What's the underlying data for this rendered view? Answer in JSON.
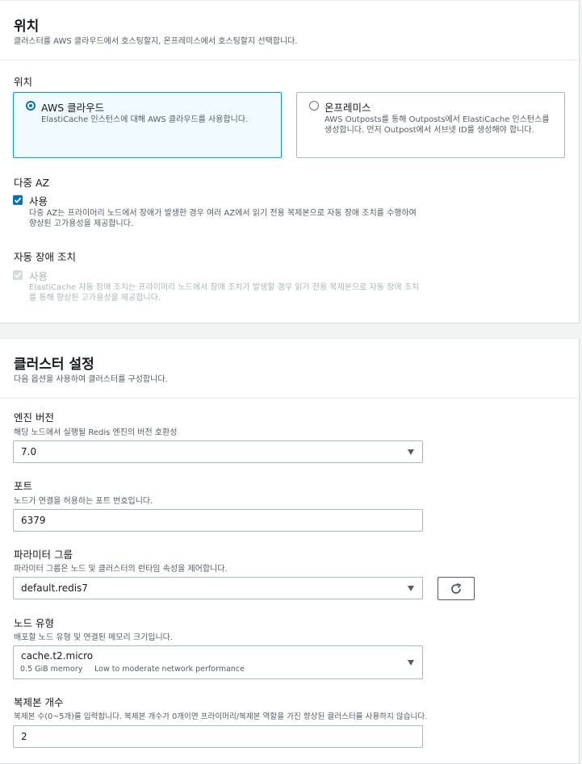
{
  "location_section": {
    "title": "위치",
    "description": "클러스터를 AWS 클라우드에서 호스팅할지, 온프레미스에서 호스팅할지 선택합니다.",
    "field_label": "위치",
    "options": [
      {
        "label": "AWS 클라우드",
        "description": "ElastiCache 인스턴스에 대해 AWS 클라우드를 사용합니다.",
        "selected": true
      },
      {
        "label": "온프레미스",
        "description": "AWS Outposts를 통해 Outposts에서 ElastiCache 인스턴스를 생성합니다. 먼저 Outpost에서 서브넷 ID를 생성해야 합니다.",
        "selected": false
      }
    ],
    "multi_az": {
      "label": "다중 AZ",
      "checkbox_label": "사용",
      "checked": true,
      "description": "다중 AZ는 프라이머리 노드에서 장애가 발생한 경우 여러 AZ에서 읽기 전용 복제본으로 자동 장애 조치를 수행하여 향상된 고가용성을 제공합니다."
    },
    "auto_failover": {
      "label": "자동 장애 조치",
      "checkbox_label": "사용",
      "checked": true,
      "disabled": true,
      "description": "ElastiCache 자동 장애 조치는 프라이머리 노드에서 장애 조치가 발생할 경우 읽기 전용 복제본으로 자동 장애 조치를 통해 향상된 고가용성을 제공합니다."
    }
  },
  "cluster_settings": {
    "title": "클러스터 설정",
    "description": "다음 옵션을 사용하여 클러스터를 구성합니다.",
    "engine_version": {
      "label": "엔진 버전",
      "description": "해당 노드에서 실행될 Redis 엔진의 버전 호환성",
      "value": "7.0"
    },
    "port": {
      "label": "포트",
      "description": "노드가 연결을 허용하는 포트 번호입니다.",
      "value": "6379"
    },
    "parameter_group": {
      "label": "파라미터 그룹",
      "description": "파라미터 그룹은 노드 및 클러스터의 런타임 속성을 제어합니다.",
      "value": "default.redis7",
      "refresh_icon": "refresh-icon"
    },
    "node_type": {
      "label": "노드 유형",
      "description": "배포할 노드 유형 및 연결된 메모리 크기입니다.",
      "value": "cache.t2.micro",
      "memory": "0.5 GiB memory",
      "network": "Low to moderate network performance"
    },
    "replicas": {
      "label": "복제본 개수",
      "description": "복제본 수(0~5개)를 입력합니다. 복제본 개수가 0개이면 프라이머리/복제본 역할을 가진 향상된 클러스터를 사용하지 않습니다.",
      "value": "2"
    }
  },
  "colors": {
    "accent": "#0073bb",
    "selected_border": "#00a1c9",
    "selected_bg": "#f1faff",
    "page_bg": "#f2f3f3"
  }
}
